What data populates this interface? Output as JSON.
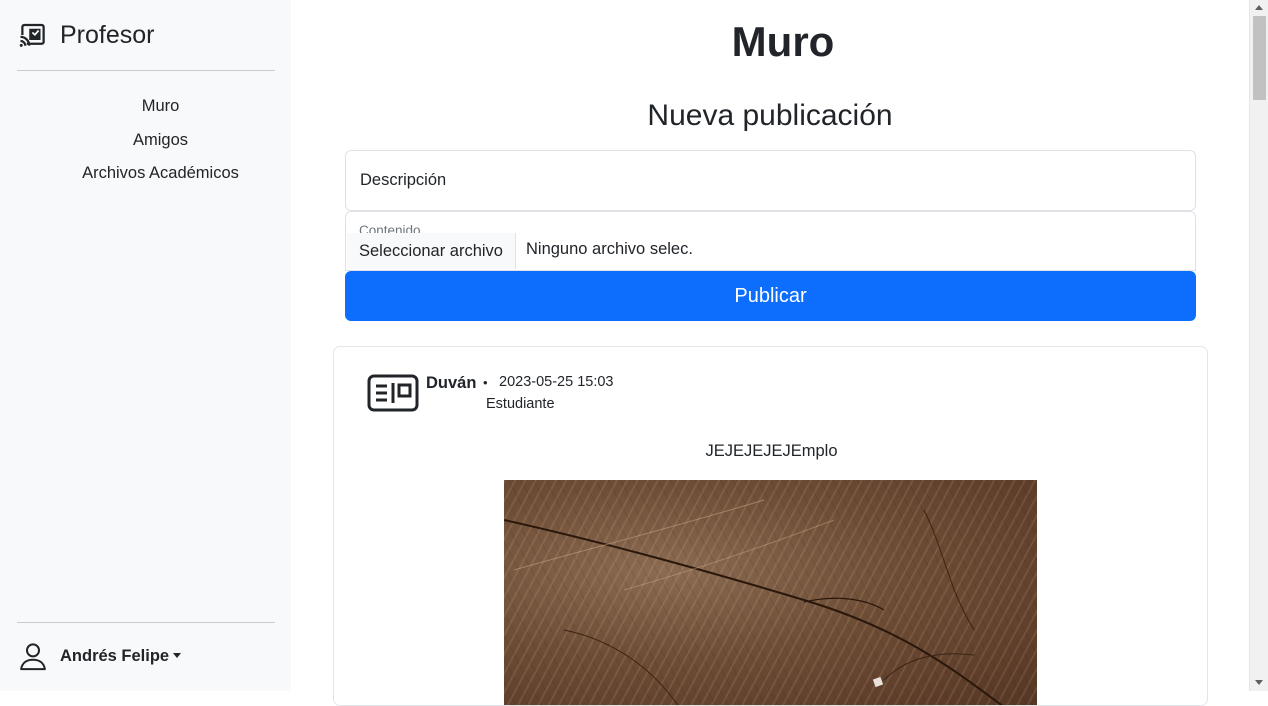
{
  "sidebar": {
    "brand": {
      "icon": "cast-connected-icon",
      "label": "Profesor"
    },
    "items": [
      {
        "label": "Muro"
      },
      {
        "label": "Amigos"
      },
      {
        "label": "Archivos Académicos"
      }
    ],
    "user": {
      "icon": "person-icon",
      "name": "Andrés Felipe"
    }
  },
  "main": {
    "title": "Muro",
    "new_post": {
      "heading": "Nueva publicación",
      "description_placeholder": "Descripción",
      "content_label": "Contenido",
      "file_button": "Seleccionar archivo",
      "file_status": "Ninguno archivo selec.",
      "publish_label": "Publicar"
    },
    "posts": [
      {
        "avatar_icon": "id-card-icon",
        "author": "Duván",
        "separator": "•",
        "date": "2023-05-25 15:03",
        "role": "Estudiante",
        "text": "JEJEJEJEJEmplo",
        "image": "wood-texture-photo"
      }
    ]
  },
  "colors": {
    "sidebar_bg": "#f8f9fa",
    "primary": "#0d6efd",
    "text": "#212529",
    "muted": "#6c757d"
  }
}
